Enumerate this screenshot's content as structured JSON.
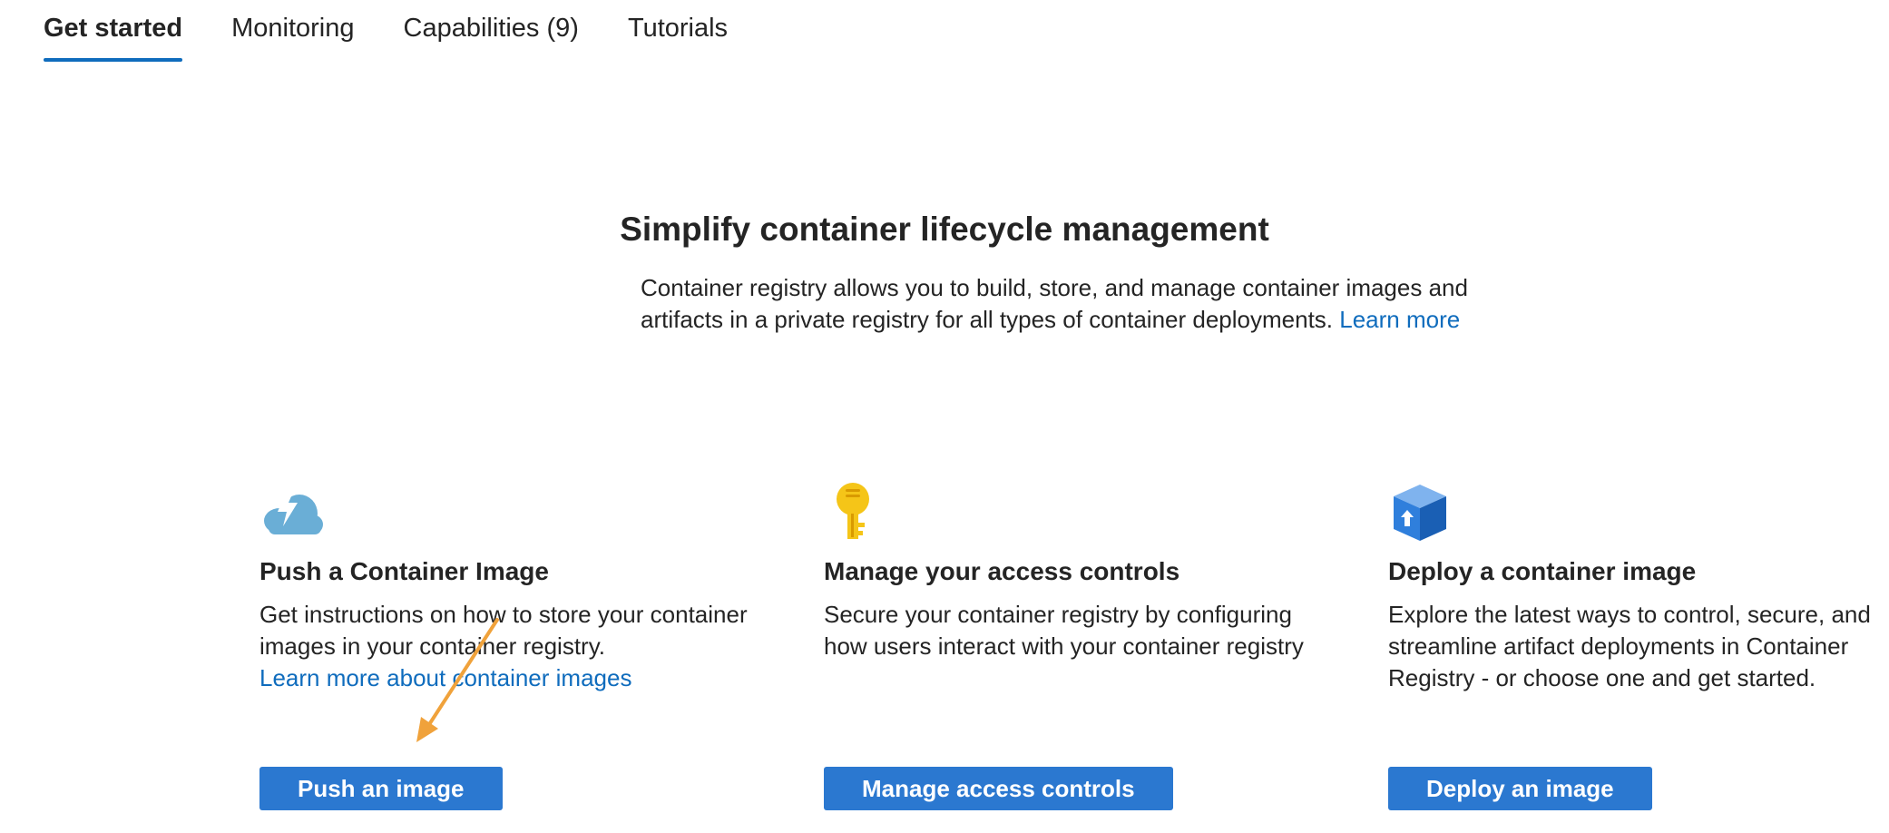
{
  "tabs": [
    {
      "label": "Get started"
    },
    {
      "label": "Monitoring"
    },
    {
      "label": "Capabilities (9)"
    },
    {
      "label": "Tutorials"
    }
  ],
  "hero": {
    "title": "Simplify container lifecycle management",
    "description": "Container registry allows you to build, store, and manage container images and artifacts in a private registry for all types of container deployments.",
    "learn_more": "Learn more"
  },
  "cards": [
    {
      "icon": "cloud-lightning-icon",
      "title": "Push a Container Image",
      "description": "Get instructions on how to store your container images in your container registry.",
      "link": "Learn more about container images",
      "button": "Push an image"
    },
    {
      "icon": "key-icon",
      "title": "Manage your access controls",
      "description": "Secure your container registry by configuring how users interact with your container registry",
      "button": "Manage access controls"
    },
    {
      "icon": "container-box-icon",
      "title": "Deploy a container image",
      "description": "Explore the latest ways to control, secure, and streamline artifact deployments in Container Registry - or choose one and get started.",
      "button": "Deploy an image"
    }
  ],
  "colors": {
    "accent": "#0f6cbd",
    "button": "#2b78d0",
    "annotation_arrow": "#f0a23b"
  }
}
